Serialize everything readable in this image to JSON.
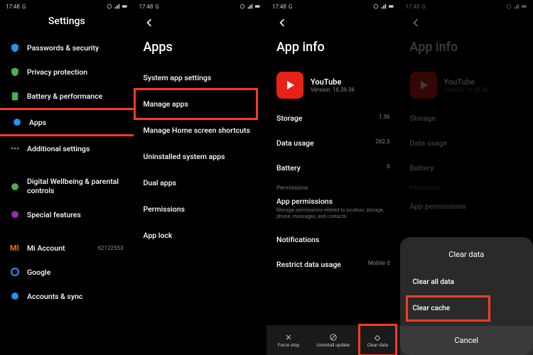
{
  "statusbar": {
    "time": "17:48",
    "network": "G"
  },
  "panel1": {
    "title": "Settings",
    "items": [
      {
        "label": "Passwords & security"
      },
      {
        "label": "Privacy protection"
      },
      {
        "label": "Battery & performance"
      },
      {
        "label": "Apps"
      },
      {
        "label": "Additional settings"
      },
      {
        "label": "Digital Wellbeing & parental controls"
      },
      {
        "label": "Special features"
      },
      {
        "label": "Mi Account",
        "right": "62122553"
      },
      {
        "label": "Google"
      },
      {
        "label": "Accounts & sync"
      }
    ]
  },
  "panel2": {
    "title": "Apps",
    "items": [
      {
        "label": "System app settings"
      },
      {
        "label": "Manage apps"
      },
      {
        "label": "Manage Home screen shortcuts"
      },
      {
        "label": "Uninstalled system apps"
      },
      {
        "label": "Dual apps"
      },
      {
        "label": "Permissions"
      },
      {
        "label": "App lock"
      }
    ]
  },
  "panel3": {
    "title": "App info",
    "app": {
      "name": "YouTube",
      "version": "Version: 16.39.36"
    },
    "rows": [
      {
        "k": "Storage",
        "v": "1.36"
      },
      {
        "k": "Data usage",
        "v": "262.3"
      },
      {
        "k": "Battery",
        "v": "0"
      }
    ],
    "permSection": "Permissions",
    "perm": {
      "title": "App permissions",
      "desc": "Manage permissions related to location, storage, phone, messages, and contacts."
    },
    "notifications": "Notifications",
    "restrict": {
      "k": "Restrict data usage",
      "v": "Mobile d"
    },
    "actions": {
      "force": "Force stop",
      "uninstall": "Uninstall update",
      "clear": "Clear data"
    }
  },
  "panel4": {
    "title": "App info",
    "app": {
      "name": "YouTube",
      "version": "Version: 16.39.36"
    },
    "rows": [
      {
        "k": "Storage"
      },
      {
        "k": "Data usage"
      },
      {
        "k": "Battery"
      }
    ],
    "permSection": "Permissions",
    "permTitle": "App permissions",
    "dialog": {
      "title": "Clear data",
      "items": [
        "Clear all data",
        "Clear cache"
      ],
      "cancel": "Cancel"
    }
  }
}
